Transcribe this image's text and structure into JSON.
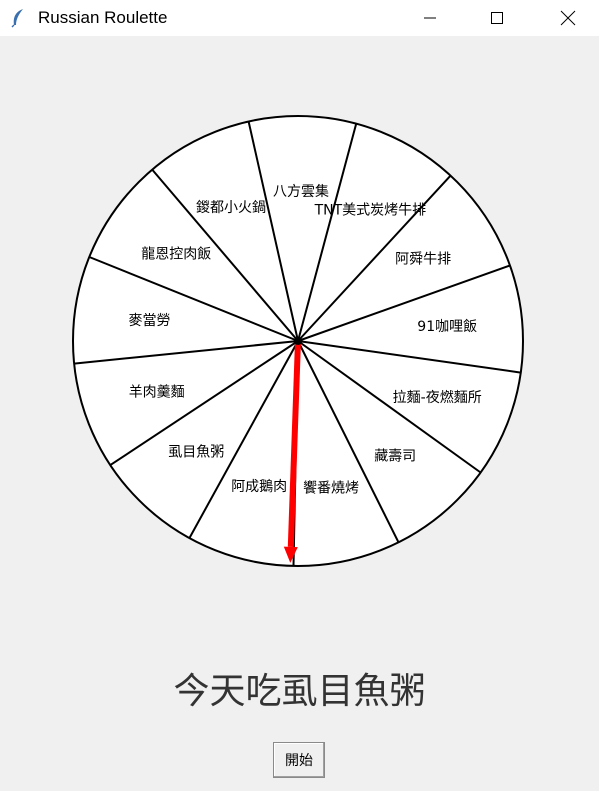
{
  "window": {
    "title": "Russian Roulette"
  },
  "wheel": {
    "segments": [
      "TNT美式炭烤牛排",
      "阿舜牛排",
      "91咖哩飯",
      "拉麵-夜燃麵所",
      "藏壽司",
      "饗番燒烤",
      "阿成鵝肉",
      "虱目魚粥",
      "羊肉羹麵",
      "麥當勞",
      "龍恩控肉飯",
      "鍐都小火鍋",
      "八方雲集"
    ],
    "pointer_color": "#ff0000",
    "pointer_angle_deg": 92
  },
  "result": {
    "text": "今天吃虱目魚粥"
  },
  "controls": {
    "start_label": "開始"
  }
}
